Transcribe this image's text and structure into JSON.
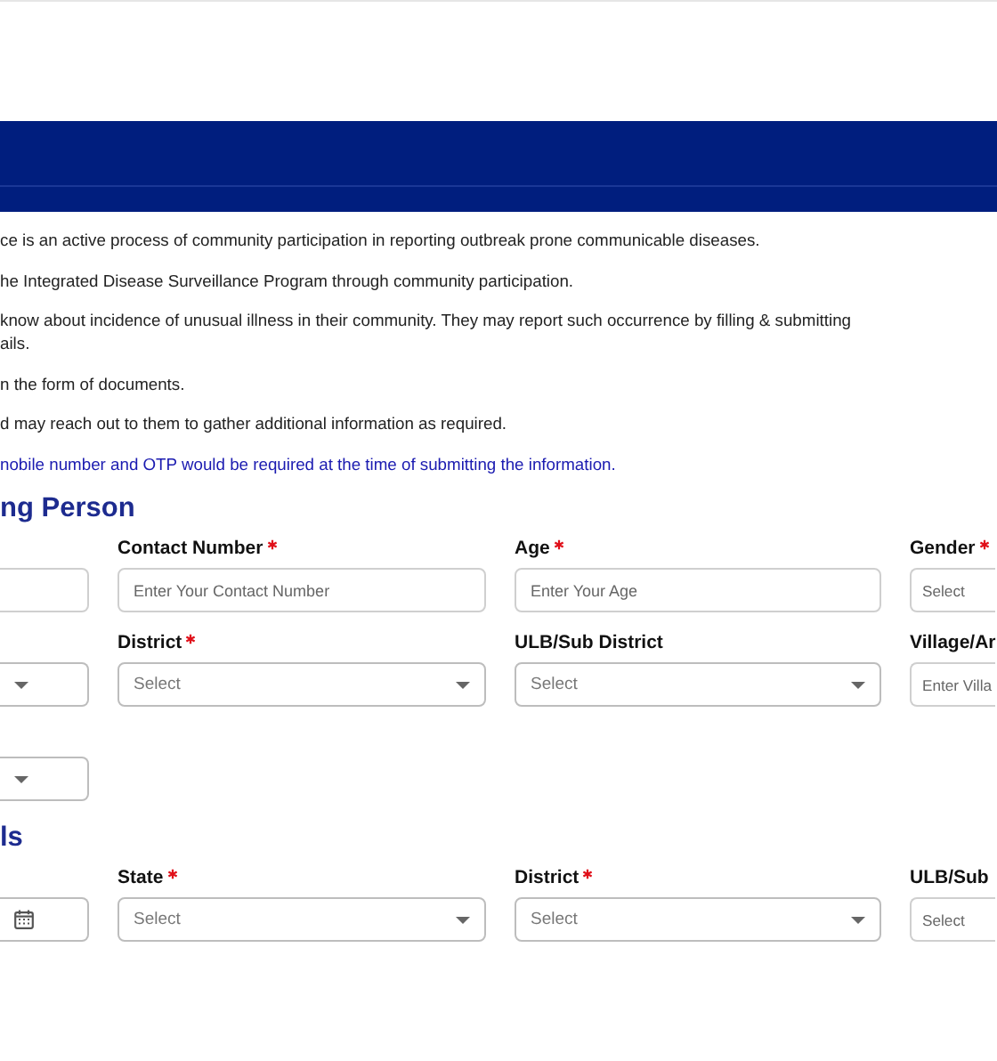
{
  "intro": [
    {
      "kind": "plain",
      "lines": [
        "ce is an active process of community participation in reporting outbreak prone communicable diseases."
      ]
    },
    {
      "kind": "plain",
      "lines": [
        "he Integrated Disease Surveillance Program through community participation."
      ]
    },
    {
      "kind": "plain",
      "lines": [
        "know about incidence of unusual illness in their community. They may report such occurrence by filling & submitting",
        "ails."
      ]
    },
    {
      "kind": "plain",
      "lines": [
        "n the form of documents."
      ]
    },
    {
      "kind": "plain",
      "lines": [
        "d may reach out to them to gather additional information as required."
      ]
    },
    {
      "kind": "note",
      "lines": [
        "nobile number and OTP would be required at the time of submitting the information."
      ]
    }
  ],
  "sections": [
    {
      "title": "ng Person",
      "rows": [
        [
          {
            "kind": "text"
          },
          {
            "kind": "text",
            "label": "Contact Number",
            "required": true,
            "placeholder": "Enter Your Contact Number"
          },
          {
            "kind": "text",
            "label": "Age",
            "required": true,
            "placeholder": "Enter Your Age"
          },
          {
            "kind": "text",
            "label": "Gender",
            "required": true,
            "placeholder": "Select"
          }
        ],
        [
          {
            "kind": "select"
          },
          {
            "kind": "select",
            "label": "District",
            "required": true,
            "placeholder": "Select"
          },
          {
            "kind": "select",
            "label": "ULB/Sub District",
            "required": false,
            "placeholder": "Select"
          },
          {
            "kind": "text",
            "label": "Village/Ar",
            "required": false,
            "placeholder": "Enter Villa"
          }
        ],
        [
          {
            "kind": "select"
          }
        ]
      ]
    },
    {
      "title": "ls",
      "rows": [
        [
          {
            "kind": "date"
          },
          {
            "kind": "select",
            "label": "State",
            "required": true,
            "placeholder": "Select"
          },
          {
            "kind": "select",
            "label": "District",
            "required": true,
            "placeholder": "Select"
          },
          {
            "kind": "text",
            "label": "ULB/Sub",
            "required": false,
            "placeholder": "Select"
          }
        ]
      ]
    }
  ]
}
